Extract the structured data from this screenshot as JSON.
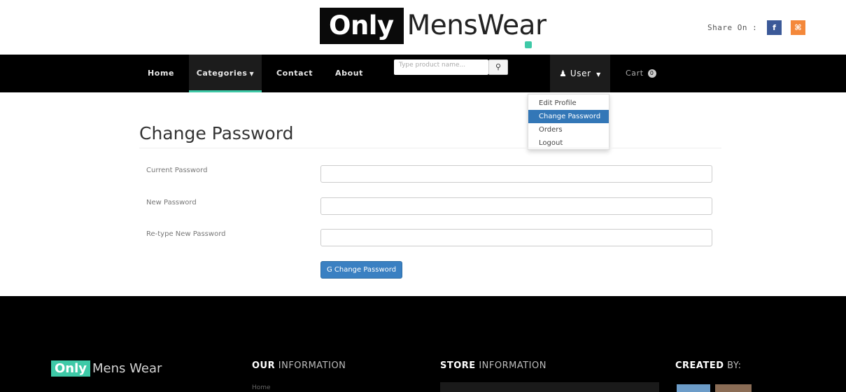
{
  "header": {
    "logo_strong": "Only",
    "logo_rest": "MensWear",
    "share_label": "Share On :",
    "social": [
      "facebook-icon",
      "rss-icon"
    ],
    "fb_glyph": "f",
    "rss_glyph": "⌘"
  },
  "nav": {
    "home": "Home",
    "categories": "Categories",
    "contact": "Contact",
    "about": "About",
    "search_placeholder": "Type product name...",
    "user": "User",
    "cart": "Cart",
    "cart_count": "0"
  },
  "user_menu": {
    "items": [
      "Edit Profile",
      "Change Password",
      "Orders",
      "Logout"
    ],
    "active_index": 1
  },
  "form": {
    "title": "Change Password",
    "fields": [
      {
        "label": "Current Password",
        "value": ""
      },
      {
        "label": "New Password",
        "value": ""
      },
      {
        "label": "Re-type New Password",
        "value": ""
      }
    ],
    "submit_label": "Change Password"
  },
  "footer": {
    "logo_strong": "Only",
    "logo_rest": "Mens Wear",
    "info_bold": "OUR",
    "info_rest": "INFORMATION",
    "store_bold": "STORE",
    "store_rest": "INFORMATION",
    "created_bold": "CREATED",
    "created_rest": "BY:",
    "first_link": "Home"
  },
  "colors": {
    "accent": "#3ec9a7",
    "navbar": "#000000",
    "button": "#3a80c2",
    "dropdown_active": "#3377b7"
  }
}
